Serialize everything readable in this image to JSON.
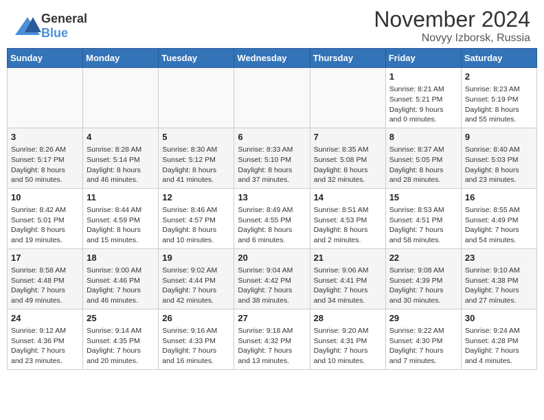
{
  "header": {
    "logo_general": "General",
    "logo_blue": "Blue",
    "month_title": "November 2024",
    "location": "Novyy Izborsk, Russia"
  },
  "weekdays": [
    "Sunday",
    "Monday",
    "Tuesday",
    "Wednesday",
    "Thursday",
    "Friday",
    "Saturday"
  ],
  "weeks": [
    [
      {
        "day": "",
        "info": ""
      },
      {
        "day": "",
        "info": ""
      },
      {
        "day": "",
        "info": ""
      },
      {
        "day": "",
        "info": ""
      },
      {
        "day": "",
        "info": ""
      },
      {
        "day": "1",
        "info": "Sunrise: 8:21 AM\nSunset: 5:21 PM\nDaylight: 9 hours and 0 minutes."
      },
      {
        "day": "2",
        "info": "Sunrise: 8:23 AM\nSunset: 5:19 PM\nDaylight: 8 hours and 55 minutes."
      }
    ],
    [
      {
        "day": "3",
        "info": "Sunrise: 8:26 AM\nSunset: 5:17 PM\nDaylight: 8 hours and 50 minutes."
      },
      {
        "day": "4",
        "info": "Sunrise: 8:28 AM\nSunset: 5:14 PM\nDaylight: 8 hours and 46 minutes."
      },
      {
        "day": "5",
        "info": "Sunrise: 8:30 AM\nSunset: 5:12 PM\nDaylight: 8 hours and 41 minutes."
      },
      {
        "day": "6",
        "info": "Sunrise: 8:33 AM\nSunset: 5:10 PM\nDaylight: 8 hours and 37 minutes."
      },
      {
        "day": "7",
        "info": "Sunrise: 8:35 AM\nSunset: 5:08 PM\nDaylight: 8 hours and 32 minutes."
      },
      {
        "day": "8",
        "info": "Sunrise: 8:37 AM\nSunset: 5:05 PM\nDaylight: 8 hours and 28 minutes."
      },
      {
        "day": "9",
        "info": "Sunrise: 8:40 AM\nSunset: 5:03 PM\nDaylight: 8 hours and 23 minutes."
      }
    ],
    [
      {
        "day": "10",
        "info": "Sunrise: 8:42 AM\nSunset: 5:01 PM\nDaylight: 8 hours and 19 minutes."
      },
      {
        "day": "11",
        "info": "Sunrise: 8:44 AM\nSunset: 4:59 PM\nDaylight: 8 hours and 15 minutes."
      },
      {
        "day": "12",
        "info": "Sunrise: 8:46 AM\nSunset: 4:57 PM\nDaylight: 8 hours and 10 minutes."
      },
      {
        "day": "13",
        "info": "Sunrise: 8:49 AM\nSunset: 4:55 PM\nDaylight: 8 hours and 6 minutes."
      },
      {
        "day": "14",
        "info": "Sunrise: 8:51 AM\nSunset: 4:53 PM\nDaylight: 8 hours and 2 minutes."
      },
      {
        "day": "15",
        "info": "Sunrise: 8:53 AM\nSunset: 4:51 PM\nDaylight: 7 hours and 58 minutes."
      },
      {
        "day": "16",
        "info": "Sunrise: 8:55 AM\nSunset: 4:49 PM\nDaylight: 7 hours and 54 minutes."
      }
    ],
    [
      {
        "day": "17",
        "info": "Sunrise: 8:58 AM\nSunset: 4:48 PM\nDaylight: 7 hours and 49 minutes."
      },
      {
        "day": "18",
        "info": "Sunrise: 9:00 AM\nSunset: 4:46 PM\nDaylight: 7 hours and 46 minutes."
      },
      {
        "day": "19",
        "info": "Sunrise: 9:02 AM\nSunset: 4:44 PM\nDaylight: 7 hours and 42 minutes."
      },
      {
        "day": "20",
        "info": "Sunrise: 9:04 AM\nSunset: 4:42 PM\nDaylight: 7 hours and 38 minutes."
      },
      {
        "day": "21",
        "info": "Sunrise: 9:06 AM\nSunset: 4:41 PM\nDaylight: 7 hours and 34 minutes."
      },
      {
        "day": "22",
        "info": "Sunrise: 9:08 AM\nSunset: 4:39 PM\nDaylight: 7 hours and 30 minutes."
      },
      {
        "day": "23",
        "info": "Sunrise: 9:10 AM\nSunset: 4:38 PM\nDaylight: 7 hours and 27 minutes."
      }
    ],
    [
      {
        "day": "24",
        "info": "Sunrise: 9:12 AM\nSunset: 4:36 PM\nDaylight: 7 hours and 23 minutes."
      },
      {
        "day": "25",
        "info": "Sunrise: 9:14 AM\nSunset: 4:35 PM\nDaylight: 7 hours and 20 minutes."
      },
      {
        "day": "26",
        "info": "Sunrise: 9:16 AM\nSunset: 4:33 PM\nDaylight: 7 hours and 16 minutes."
      },
      {
        "day": "27",
        "info": "Sunrise: 9:18 AM\nSunset: 4:32 PM\nDaylight: 7 hours and 13 minutes."
      },
      {
        "day": "28",
        "info": "Sunrise: 9:20 AM\nSunset: 4:31 PM\nDaylight: 7 hours and 10 minutes."
      },
      {
        "day": "29",
        "info": "Sunrise: 9:22 AM\nSunset: 4:30 PM\nDaylight: 7 hours and 7 minutes."
      },
      {
        "day": "30",
        "info": "Sunrise: 9:24 AM\nSunset: 4:28 PM\nDaylight: 7 hours and 4 minutes."
      }
    ]
  ]
}
